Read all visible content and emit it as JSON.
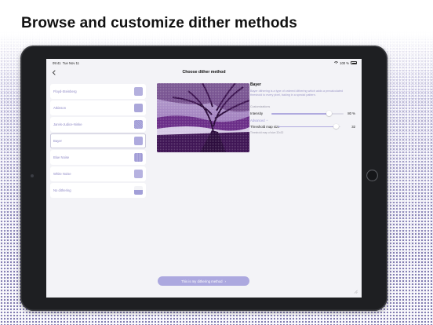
{
  "headline": "Browse and customize dither methods",
  "statusbar": {
    "time": "09:41",
    "date": "Tue Nov 11",
    "battery_text": "100 %"
  },
  "nav": {
    "title": "Choose dither method",
    "back_icon": "chevron-left-icon"
  },
  "methods": [
    {
      "label": "Floyd-Steinberg"
    },
    {
      "label": "Atkinson"
    },
    {
      "label": "Jarvis-Judice-Ninke"
    },
    {
      "label": "Bayer",
      "selected": true
    },
    {
      "label": "Blue Noise"
    },
    {
      "label": "White Noise"
    },
    {
      "label": "No dithering"
    }
  ],
  "detail": {
    "title": "Bayer",
    "description": "Bayer dithering is a type of ordered dithering which adds a precalculated threshold to every pixel, baking in a special pattern.",
    "customizations_label": "Customizations",
    "intensity_label": "Intensity",
    "intensity_value": "80 %",
    "intensity_fraction": 0.8,
    "advanced_label": "Advanced",
    "threshold_label": "Threshold map size",
    "threshold_value": "32",
    "threshold_fraction": 0.93,
    "threshold_hint": "Threshold map of size 32x32"
  },
  "cta": {
    "label": "This is my dithering method"
  },
  "colors": {
    "accent": "#aca8df",
    "list_text": "#8f89c6",
    "photo_tint": "#6e2e86"
  }
}
